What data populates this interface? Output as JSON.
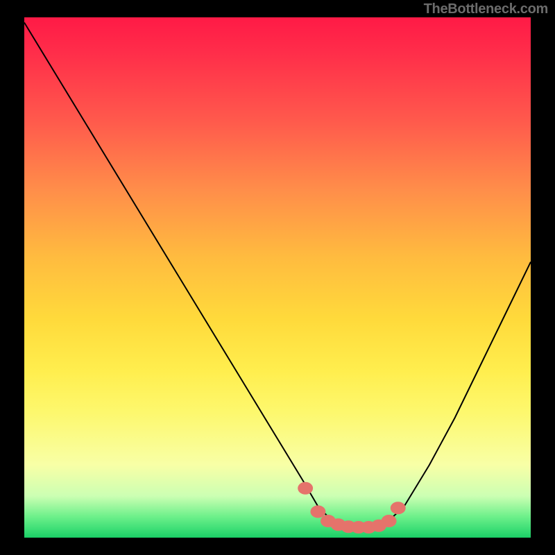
{
  "attribution": "TheBottleneck.com",
  "chart_data": {
    "type": "line",
    "title": "",
    "xlabel": "",
    "ylabel": "",
    "xlim": [
      0,
      100
    ],
    "ylim": [
      0,
      100
    ],
    "grid": false,
    "series": [
      {
        "name": "bottleneck-curve",
        "x": [
          0,
          5,
          10,
          15,
          20,
          25,
          30,
          35,
          40,
          45,
          50,
          55,
          58,
          60,
          62,
          64,
          66,
          68,
          70,
          72,
          75,
          80,
          85,
          90,
          95,
          100
        ],
        "y": [
          99,
          91,
          83,
          75,
          67,
          59,
          51,
          43,
          35,
          27,
          19,
          11,
          6,
          4.0,
          2.8,
          2.2,
          2.0,
          2.0,
          2.4,
          3.3,
          6,
          14,
          23,
          33,
          43,
          53
        ]
      },
      {
        "name": "optimal-band-markers",
        "x": [
          55.5,
          58.0,
          60.0,
          62.0,
          64.0,
          66.0,
          68.0,
          70.0,
          72.0,
          73.8
        ],
        "y": [
          9.5,
          5.0,
          3.2,
          2.5,
          2.1,
          2.0,
          2.0,
          2.3,
          3.2,
          5.7
        ]
      }
    ],
    "colors": {
      "gradient_top": "#ff1a46",
      "gradient_mid": "#ffda3b",
      "gradient_bottom": "#1bce66",
      "curve": "#000000",
      "markers": "#e5736b"
    }
  }
}
